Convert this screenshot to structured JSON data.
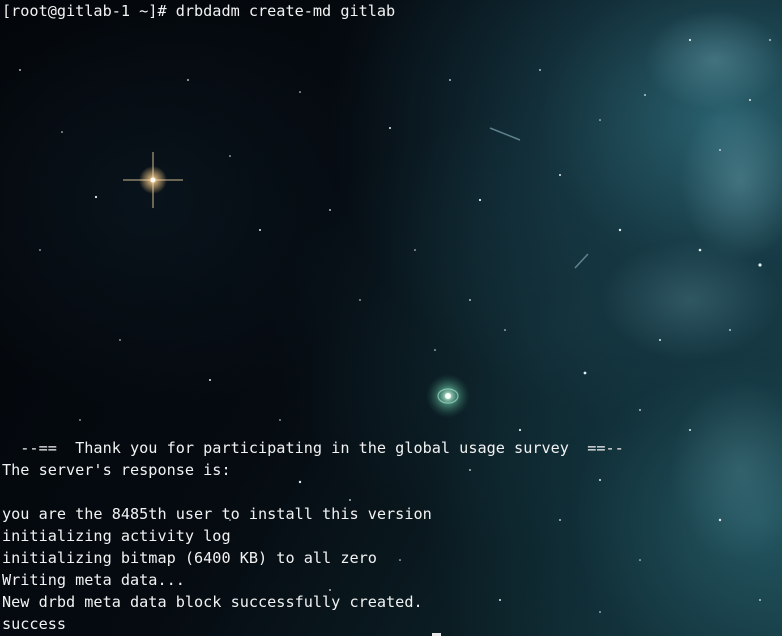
{
  "terminal": {
    "lines": {
      "command_prompt": "[root@gitlab-1 ~]# drbdadm create-md gitlab",
      "survey_banner": "  --==  Thank you for participating in the global usage survey  ==--",
      "server_response": "The server's response is:",
      "user_count": "you are the 8485th user to install this version",
      "activity_log": "initializing activity log",
      "bitmap": "initializing bitmap (6400 KB) to all zero",
      "writing_meta": "Writing meta data...",
      "meta_created": "New drbd meta data block successfully created.",
      "success": "success"
    }
  },
  "background": {
    "icon": "space-nebula-wallpaper",
    "accent_color": "#2e6c7a",
    "text_color": "#f2f2f2"
  }
}
